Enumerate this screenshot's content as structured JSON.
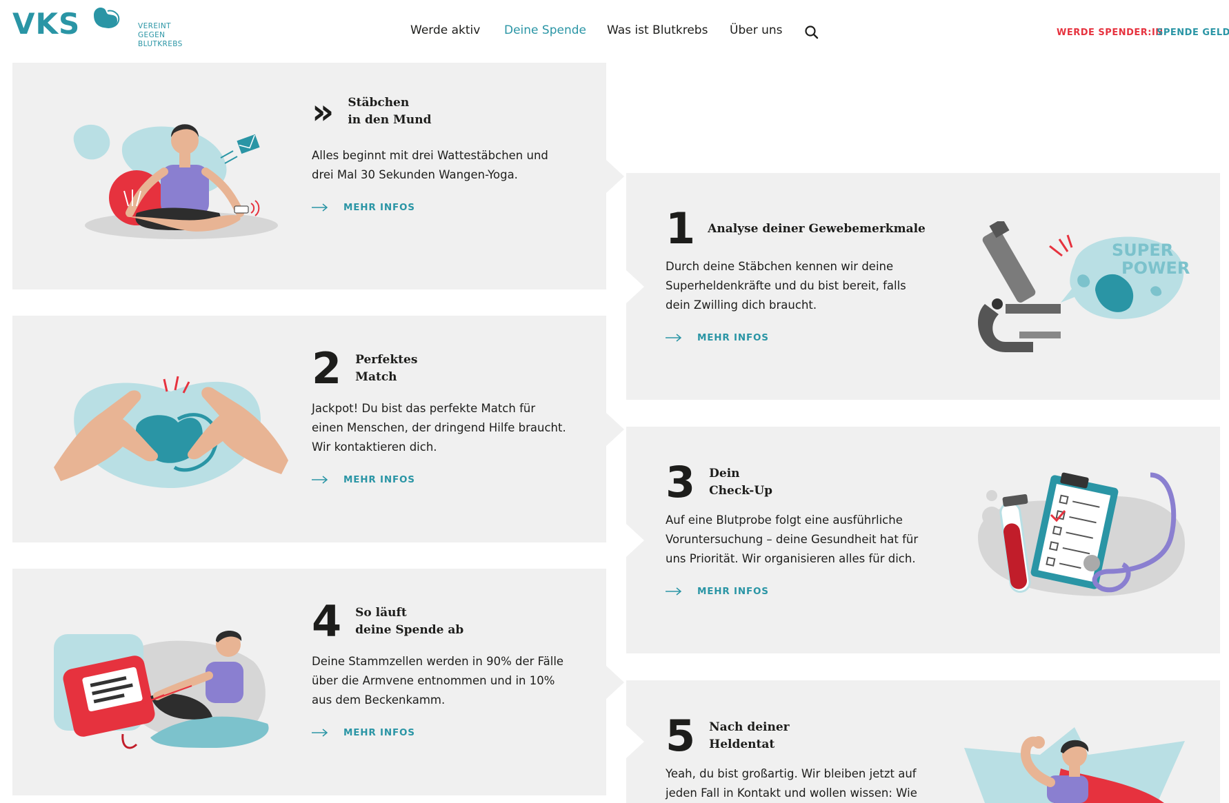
{
  "brand": {
    "logo_text": "VKS",
    "claim_line1": "VEREINT",
    "claim_line2": "GEGEN BLUTKREBS",
    "accent": "#2a95a5",
    "accent_red": "#e6323e",
    "card_bg": "#f0f0f0"
  },
  "nav": {
    "items": [
      {
        "label": "Werde aktiv",
        "active": false
      },
      {
        "label": "Deine Spende",
        "active": true
      },
      {
        "label": "Was ist Blutkrebs",
        "active": false
      },
      {
        "label": "Über uns",
        "active": false
      }
    ],
    "search_icon": "search-icon",
    "cta_primary": "WERDE SPENDER:IN",
    "cta_secondary": "SPENDE GELD"
  },
  "steps": [
    {
      "marker": "»",
      "title_line1": "Stäbchen",
      "title_line2": "in den Mund",
      "text": [
        "Alles beginnt mit drei Wattestäbchen und",
        "drei Mal 30 Sekunden Wangen-Yoga."
      ],
      "more": "MEHR INFOS",
      "illustration": "meditating-man-with-swab-icon"
    },
    {
      "marker": "1",
      "title_line1": "Analyse deiner Gewebemerkmale",
      "text": [
        "Durch deine Stäbchen kennen wir deine",
        "Superheldenkräfte und du bist bereit, falls",
        "dein Zwilling dich braucht."
      ],
      "more": "MEHR INFOS",
      "illustration": "microscope-superpower-icon",
      "speech_bubble_text_1": "SUPER",
      "speech_bubble_text_2": "POWER"
    },
    {
      "marker": "2",
      "title_line1": "Perfektes",
      "title_line2": "Match",
      "text": [
        "Jackpot! Du bist das perfekte Match für",
        "einen Menschen, der dringend Hilfe braucht.",
        "Wir kontaktieren dich."
      ],
      "more": "MEHR INFOS",
      "illustration": "hands-forming-heart-icon"
    },
    {
      "marker": "3",
      "title_line1": "Dein",
      "title_line2": "Check-Up",
      "text": [
        "Auf eine Blutprobe folgt eine ausführliche",
        "Voruntersuchung – deine Gesundheit hat für",
        "uns Priorität. Wir organisieren alles für dich."
      ],
      "more": "MEHR INFOS",
      "illustration": "clipboard-stethoscope-icon"
    },
    {
      "marker": "4",
      "title_line1": "So läuft",
      "title_line2": "deine Spende ab",
      "text": [
        "Deine Stammzellen werden in 90% der Fälle",
        "über die Armvene entnommen und in 10%",
        "aus dem Beckenkamm."
      ],
      "more": "MEHR INFOS",
      "illustration": "blood-bag-donor-icon"
    },
    {
      "marker": "5",
      "title_line1": "Nach deiner",
      "title_line2": "Heldentat",
      "text": [
        "Yeah, du bist großartig. Wir bleiben jetzt auf",
        "jeden Fall in Kontakt und wollen wissen: Wie"
      ],
      "more": "",
      "illustration": "superhero-flexing-icon"
    }
  ]
}
